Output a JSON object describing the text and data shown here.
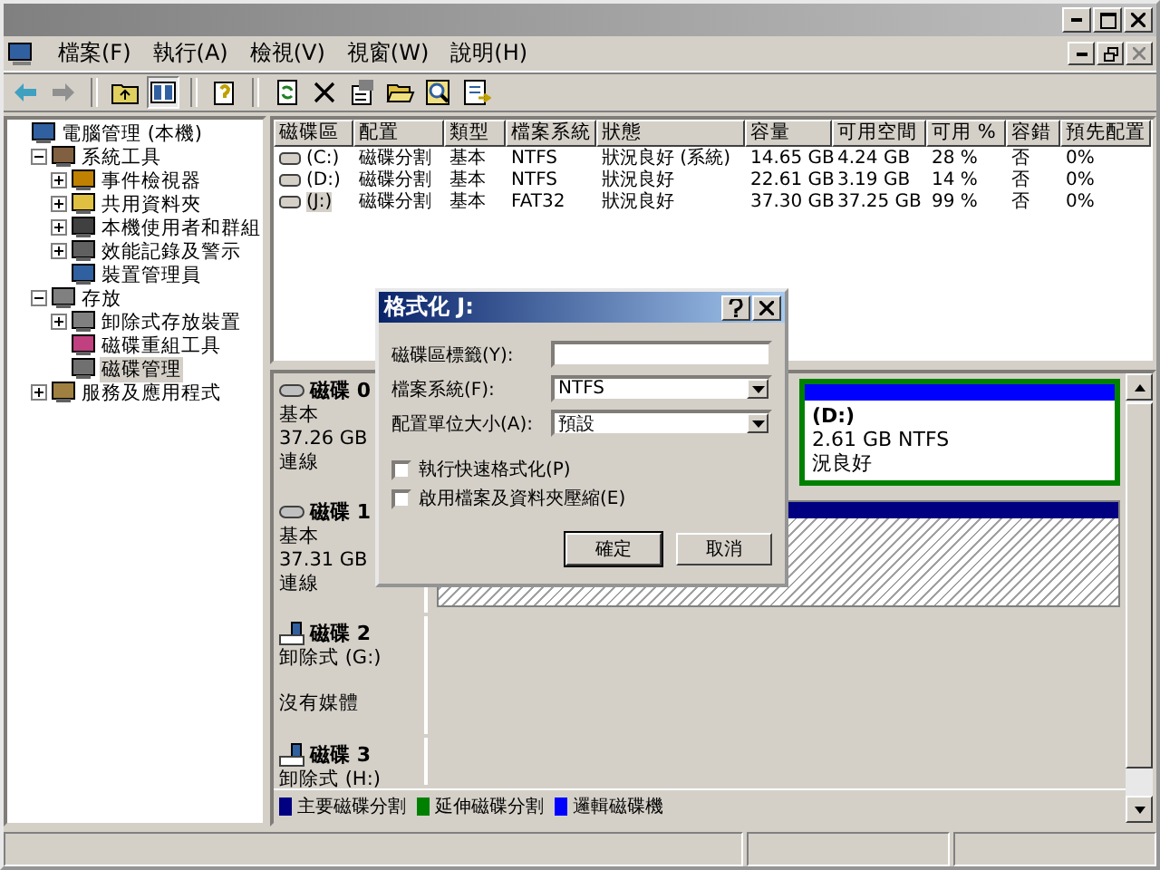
{
  "menu": [
    "檔案(F)",
    "執行(A)",
    "檢視(V)",
    "視窗(W)",
    "說明(H)"
  ],
  "tree": [
    {
      "label": "電腦管理 (本機)",
      "selected": false,
      "children": [
        {
          "label": "系統工具",
          "selected": false,
          "expanded": true,
          "children": [
            {
              "label": "事件檢視器",
              "selected": false,
              "expanded": false
            },
            {
              "label": "共用資料夾",
              "selected": false,
              "expanded": false
            },
            {
              "label": "本機使用者和群組",
              "selected": false,
              "expanded": false
            },
            {
              "label": "效能記錄及警示",
              "selected": false,
              "expanded": false
            },
            {
              "label": "裝置管理員",
              "selected": false
            }
          ]
        },
        {
          "label": "存放",
          "selected": false,
          "expanded": true,
          "children": [
            {
              "label": "卸除式存放裝置",
              "selected": false,
              "expanded": false
            },
            {
              "label": "磁碟重組工具",
              "selected": false
            },
            {
              "label": "磁碟管理",
              "selected": true
            }
          ]
        },
        {
          "label": "服務及應用程式",
          "selected": false,
          "expanded": false
        }
      ]
    }
  ],
  "volumes": {
    "columns": [
      "磁碟區",
      "配置",
      "類型",
      "檔案系統",
      "狀態",
      "容量",
      "可用空間",
      "可用 %",
      "容錯",
      "預先配置"
    ],
    "rows": [
      {
        "selected": false,
        "cells": [
          "(C:)",
          "磁碟分割",
          "基本",
          "NTFS",
          "狀況良好 (系統)",
          "14.65 GB",
          "4.24 GB",
          "28 %",
          "否",
          "0%"
        ]
      },
      {
        "selected": false,
        "cells": [
          "(D:)",
          "磁碟分割",
          "基本",
          "NTFS",
          "狀況良好",
          "22.61 GB",
          "3.19 GB",
          "14 %",
          "否",
          "0%"
        ]
      },
      {
        "selected": true,
        "cells": [
          "(J:)",
          "磁碟分割",
          "基本",
          "FAT32",
          "狀況良好",
          "37.30 GB",
          "37.25 GB",
          "99 %",
          "否",
          "0%"
        ]
      }
    ]
  },
  "disks": [
    {
      "kind": "basic",
      "name": "磁碟 0",
      "lines": [
        "基本",
        "37.26 GB",
        "連線"
      ],
      "partition": {
        "kind": "extended",
        "lines": [
          "(D:)",
          "2.61 GB NTFS",
          "況良好"
        ]
      }
    },
    {
      "kind": "basic",
      "name": "磁碟 1",
      "lines": [
        "基本",
        "37.31 GB",
        "連線"
      ],
      "partition": {
        "kind": "unallocated"
      }
    },
    {
      "kind": "removable",
      "name": "磁碟 2",
      "lines": [
        "卸除式 (G:)",
        "沒有媒體"
      ]
    },
    {
      "kind": "removable",
      "name": "磁碟 3",
      "lines": [
        "卸除式 (H:)"
      ]
    }
  ],
  "legend": [
    {
      "label": "主要磁碟分割",
      "color": "#000080"
    },
    {
      "label": "延伸磁碟分割",
      "color": "#008000"
    },
    {
      "label": "邏輯磁碟機",
      "color": "#0000ff"
    }
  ],
  "dialog": {
    "title": "格式化 J:",
    "fields": [
      {
        "kind": "text",
        "label": "磁碟區標籤(Y):"
      },
      {
        "kind": "select",
        "label": "檔案系統(F):",
        "value": "NTFS"
      },
      {
        "kind": "select",
        "label": "配置單位大小(A):",
        "value": "預設"
      }
    ],
    "checkboxes": [
      {
        "label": "執行快速格式化(P)",
        "checked": false
      },
      {
        "label": "啟用檔案及資料夾壓縮(E)",
        "checked": false
      }
    ],
    "buttons": [
      {
        "label": "確定",
        "default": true
      },
      {
        "label": "取消",
        "default": false
      }
    ]
  }
}
